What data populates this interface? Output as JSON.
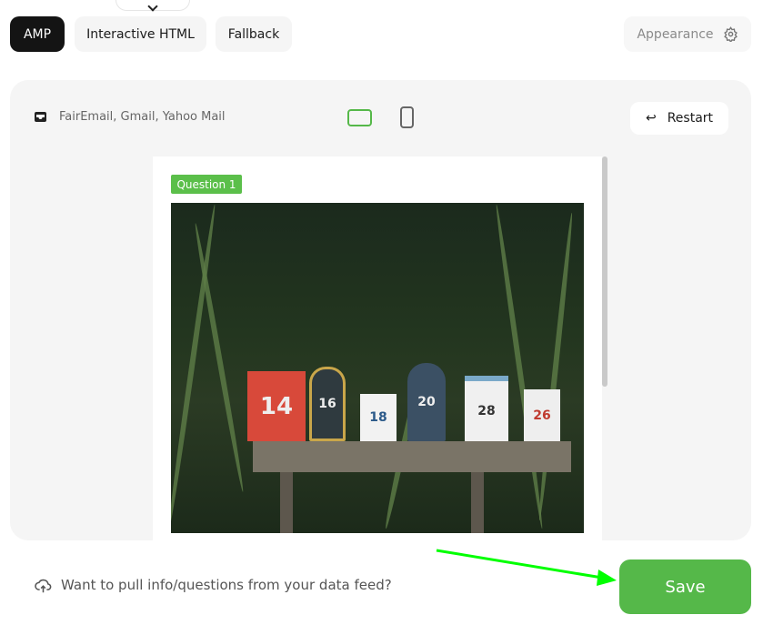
{
  "tabs": [
    {
      "label": "AMP",
      "active": true
    },
    {
      "label": "Interactive HTML",
      "active": false
    },
    {
      "label": "Fallback",
      "active": false
    }
  ],
  "appearance": {
    "label": "Appearance",
    "icon": "gear-icon"
  },
  "preview": {
    "clients": "FairEmail, Gmail, Yahoo Mail",
    "client_icon": "inbox-icon",
    "device_selected": "desktop",
    "restart_label": "Restart",
    "question_badge": "Question 1",
    "mailbox_numbers": [
      "14",
      "16",
      "18",
      "20",
      "28",
      "26"
    ]
  },
  "footer": {
    "data_feed_text": "Want to pull info/questions from your data feed?",
    "save_label": "Save"
  },
  "colors": {
    "accent": "#55b849",
    "active_tab": "#141414",
    "annotation_arrow": "#00ff00"
  }
}
